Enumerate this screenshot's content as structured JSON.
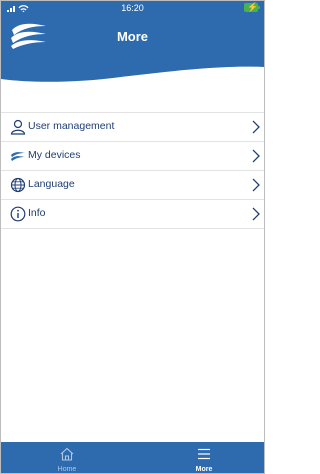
{
  "status_bar": {
    "time": "16:20"
  },
  "header": {
    "title": "More"
  },
  "menu": {
    "items": [
      {
        "label": "User management",
        "icon": "user-icon"
      },
      {
        "label": "My devices",
        "icon": "devices-wave-icon"
      },
      {
        "label": "Language",
        "icon": "globe-icon"
      },
      {
        "label": "Info",
        "icon": "info-icon"
      }
    ]
  },
  "tab_bar": {
    "tabs": [
      {
        "label": "Home",
        "icon": "home-icon",
        "active": false
      },
      {
        "label": "More",
        "icon": "menu-icon",
        "active": true
      }
    ]
  },
  "colors": {
    "brand_blue": "#2d6aae",
    "label_navy": "#1f3e73",
    "tab_inactive": "#b5c8e2"
  }
}
